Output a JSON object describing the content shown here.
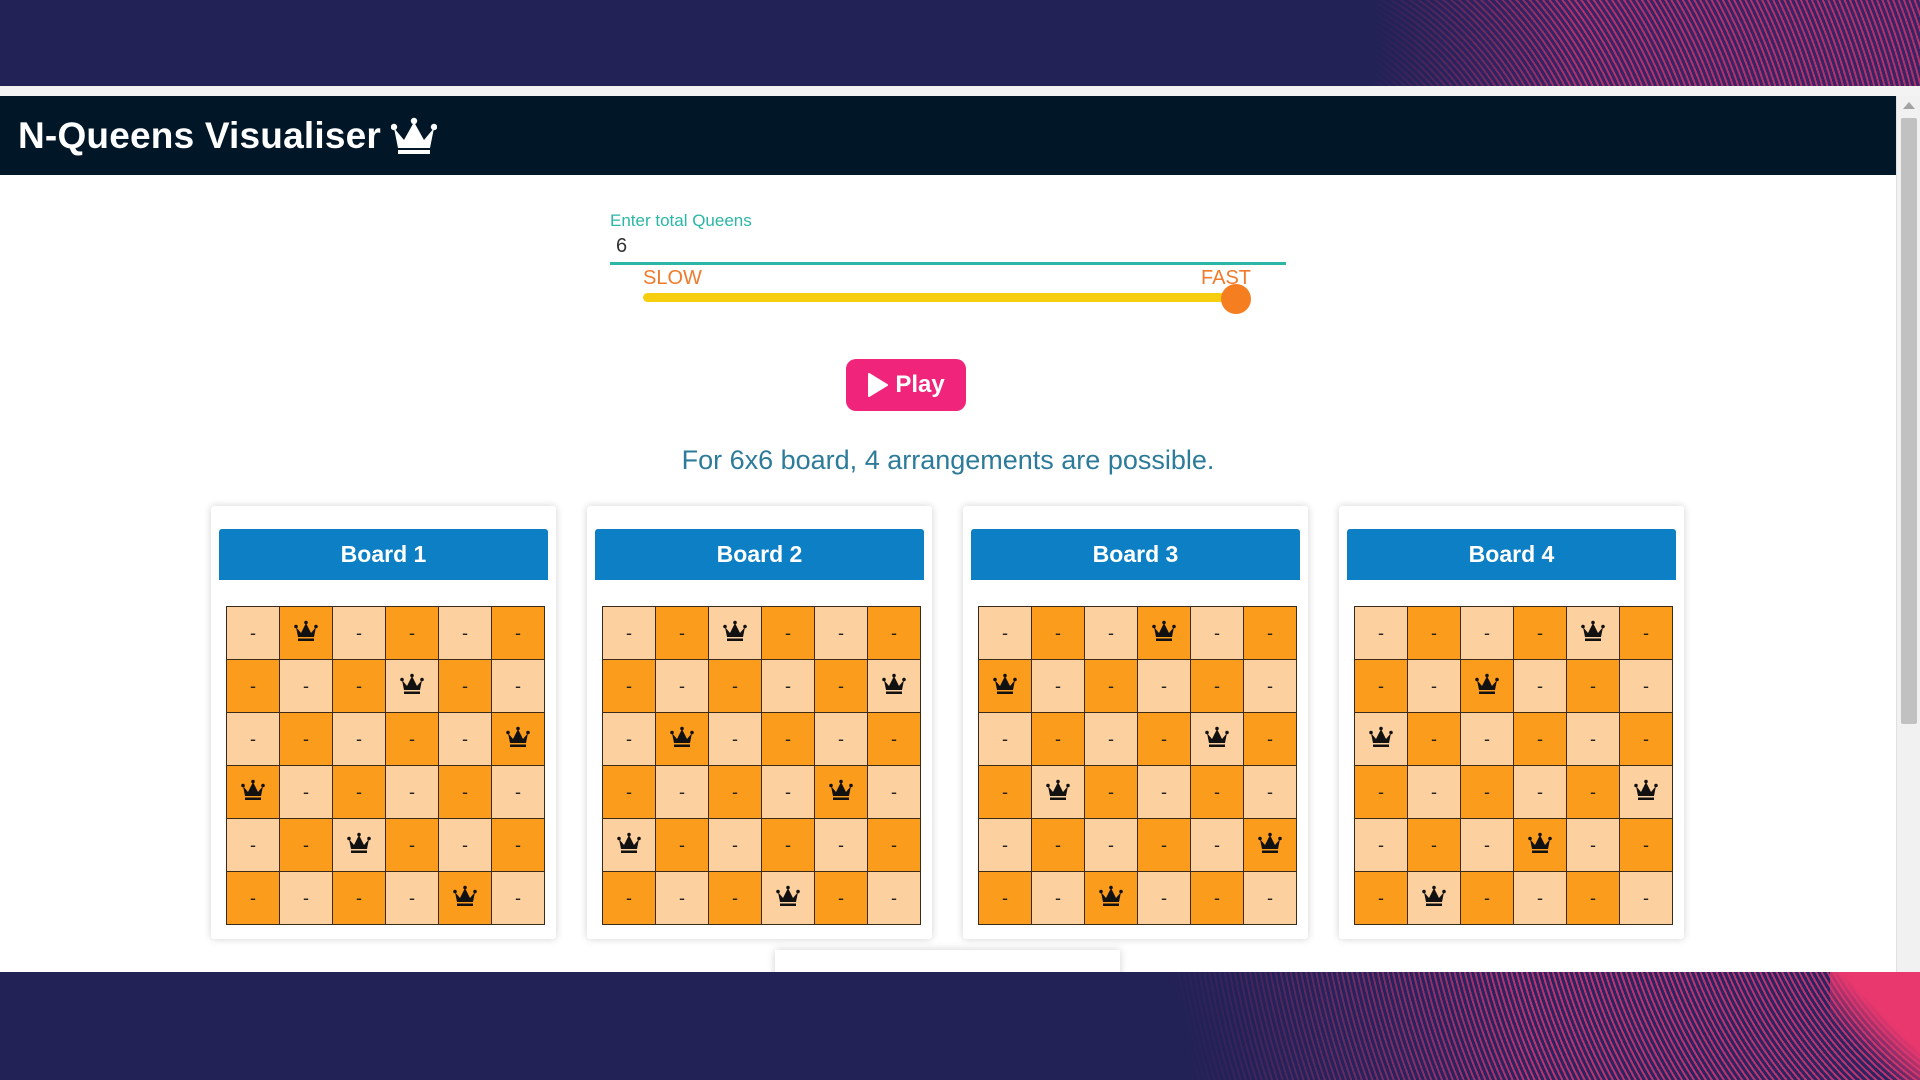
{
  "app": {
    "title": "N-Queens Visualiser",
    "title_icon": "crown-icon"
  },
  "controls": {
    "queens_label": "Enter total Queens",
    "queens_value": "6",
    "speed_slow_label": "SLOW",
    "speed_fast_label": "FAST",
    "speed_level": 1.0,
    "play_label": "Play",
    "play_icon": "play-icon"
  },
  "summary": "For 6x6 board, 4 arrangements are possible.",
  "colors": {
    "navbar": "#011627",
    "accent_teal": "#2bb6a6",
    "slider_track": "#f7cd10",
    "slider_thumb": "#f57e20",
    "play_button": "#f0247a",
    "board_header": "#0d7fc5",
    "cell_light": "#fdd0a0",
    "cell_dark": "#fc9c1d"
  },
  "empty_symbol": "-",
  "queen_icon": "queen-crown-icon",
  "boards": [
    {
      "title": "Board 1",
      "queen_cols": [
        1,
        3,
        5,
        0,
        2,
        4
      ]
    },
    {
      "title": "Board 2",
      "queen_cols": [
        2,
        5,
        1,
        4,
        0,
        3
      ]
    },
    {
      "title": "Board 3",
      "queen_cols": [
        3,
        0,
        4,
        1,
        5,
        2
      ]
    },
    {
      "title": "Board 4",
      "queen_cols": [
        4,
        2,
        0,
        5,
        3,
        1
      ]
    }
  ]
}
